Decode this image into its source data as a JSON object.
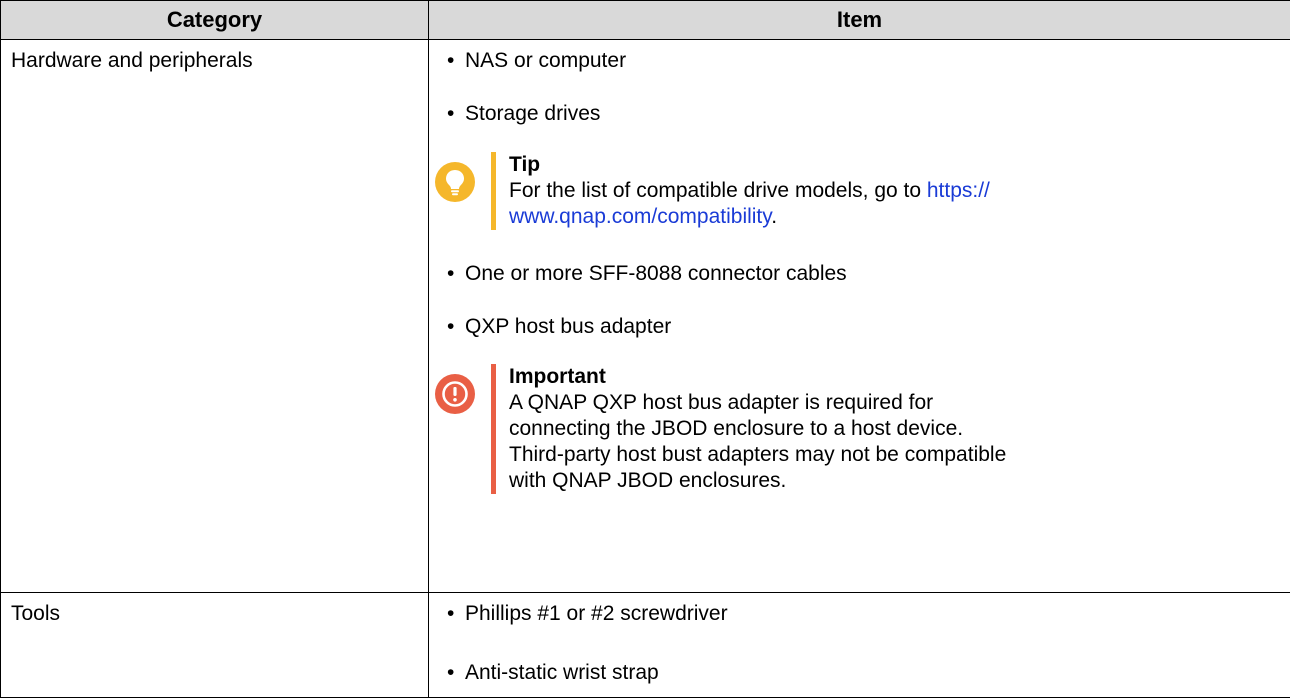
{
  "table": {
    "headers": [
      "Category",
      "Item"
    ],
    "rows": [
      {
        "category": "Hardware and peripherals",
        "items": [
          "NAS or computer",
          "Storage drives"
        ],
        "tip": {
          "title": "Tip",
          "text_before": "For the list of compatible drive models, go to ",
          "link_line1": "https://",
          "link_line2": "www.qnap.com/compatibility",
          "text_after": "."
        },
        "items_after_tip": [
          "One or more SFF-8088 connector cables",
          "QXP host bus adapter"
        ],
        "important": {
          "title": "Important",
          "lines": [
            "A QNAP QXP host bus adapter is required for",
            "connecting the JBOD enclosure to a host device.",
            "Third-party host bust adapters may not be compatible",
            "with QNAP JBOD enclosures."
          ]
        }
      },
      {
        "category": "Tools",
        "items": [
          "Phillips #1 or #2 screwdriver",
          "Anti-static wrist strap"
        ]
      }
    ]
  },
  "bullet_glyph": "•",
  "colors": {
    "header_bg": "#d9d9d9",
    "tip": "#f5b72b",
    "important": "#e95f45",
    "link": "#1a3bd6"
  },
  "icons": {
    "tip": "lightbulb-icon",
    "important": "exclamation-icon"
  }
}
